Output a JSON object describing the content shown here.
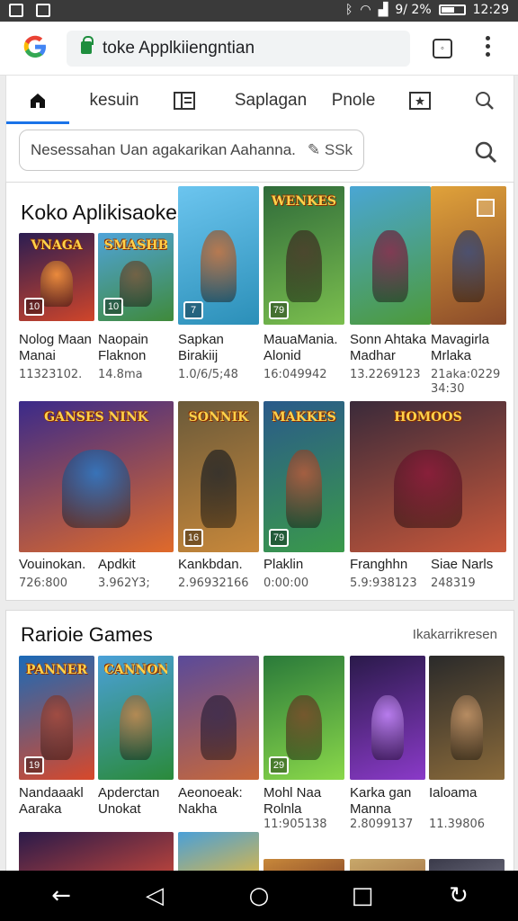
{
  "status": {
    "battery": "9/ 2%",
    "time": "12:29"
  },
  "browser": {
    "url": "toke Applkiiengntian"
  },
  "tabs": [
    {
      "label": ""
    },
    {
      "label": "kesuin"
    },
    {
      "label": ""
    },
    {
      "label": "Saplagan"
    },
    {
      "label": "Pnole"
    },
    {
      "label": ""
    },
    {
      "label": ""
    }
  ],
  "search": {
    "placeholder": "Nesessahan Uan agakarikan Aahanna.",
    "suffix": "SSk"
  },
  "section1": {
    "title": "Koko Aplikisaokeannh",
    "row1": [
      {
        "name1": "Nolog Maan",
        "name2": "Manai",
        "meta1": "11323102.",
        "meta2": "",
        "badge": "10",
        "logo": "VNAGA",
        "c1": "#2b1d52",
        "c2": "#d0452a",
        "fig": "#ff9a3c"
      },
      {
        "name1": "Naopain",
        "name2": "Flaknon",
        "meta1": "14.8ma",
        "meta2": "",
        "badge": "10",
        "logo": "SMASHBLE",
        "c1": "#4fa3d8",
        "c2": "#3f8a3a",
        "fig": "#7a5a3a"
      },
      {
        "name1": "Sapkan",
        "name2": "Birakiij",
        "meta1": "1.0/6/5;48",
        "meta2": "",
        "badge": "7",
        "logo": "",
        "c1": "#6cc5ef",
        "c2": "#2b8fb8",
        "fig": "#c9713a"
      },
      {
        "name1": "MauaMania.",
        "name2": "Alonid",
        "meta1": "16:049942",
        "meta2": "",
        "badge": "79",
        "logo": "WENKES",
        "c1": "#2f6b3a",
        "c2": "#7bbf4e",
        "fig": "#4a3a2a"
      },
      {
        "name1": "Sonn Ahtaka",
        "name2": "Madhar",
        "meta1": "13.2269123",
        "meta2": "",
        "badge": "",
        "logo": "",
        "c1": "#4aa6d4",
        "c2": "#4c9a3a",
        "fig": "#8a2a4a"
      },
      {
        "name1": "Mavagirla",
        "name2": "Mrlaka",
        "meta1": "21aka:0229",
        "meta2": "34:30",
        "badge": "",
        "logo": "",
        "c1": "#e0a23a",
        "c2": "#8a4a2a",
        "fig": "#3a4a7a"
      }
    ],
    "row2": [
      {
        "name1": "Vouinokan.",
        "meta1": "726:800",
        "badge": "",
        "logo": "GANSES NINK",
        "c1": "#3a2a8a",
        "c2": "#e06a2a",
        "fig": "#2a7ac8"
      },
      {
        "name1": "Apdkit",
        "meta1": "3.962Y3;",
        "badge": "16",
        "logo": "SONNIK",
        "c1": "#6a5a3a",
        "c2": "#c8883a",
        "fig": "#2a2a2a"
      },
      {
        "name1": "Kankbdan.",
        "meta1": "2.96932166",
        "badge": "79",
        "logo": "MAKKES",
        "c1": "#2a5a8a",
        "c2": "#3a9a4a",
        "fig": "#b85a3a"
      },
      {
        "name1": "Plaklin",
        "meta1": "0:00:00",
        "badge": "",
        "logo": "",
        "c1": "",
        "c2": "",
        "fig": ""
      },
      {
        "name1": "Franghhn",
        "meta1": "5.9:938123",
        "badge": "",
        "logo": "HOMOOS",
        "c1": "#3a2a3a",
        "c2": "#c8583a",
        "fig": "#8a1a3a"
      },
      {
        "name1": "Siae Narls",
        "meta1": "248319",
        "badge": "",
        "logo": "",
        "c1": "",
        "c2": "",
        "fig": ""
      }
    ]
  },
  "section2": {
    "title": "Rarioie Games",
    "link": "Ikakarrikresen",
    "row1": [
      {
        "name1": "Nandaaakl",
        "name2": "Aaraka",
        "meta1": "",
        "badge": "19",
        "logo": "PANNER",
        "c1": "#1a6ab8",
        "c2": "#d8482a",
        "fig": "#a84a3a"
      },
      {
        "name1": "Apderctan",
        "name2": "Unokat",
        "meta1": "",
        "badge": "",
        "logo": "CANNON",
        "c1": "#4aa0d8",
        "c2": "#2a8a3a",
        "fig": "#c8884a"
      },
      {
        "name1": "Aeonoeak:",
        "name2": "Nakha",
        "meta1": "",
        "badge": "",
        "logo": "",
        "c1": "#5a4a9a",
        "c2": "#c8683a",
        "fig": "#3a2a4a"
      },
      {
        "name1": "Mohl Naa",
        "name2": "Rolnla",
        "meta1": "11:905138",
        "badge": "29",
        "logo": "",
        "c1": "#2a7a3a",
        "c2": "#8ad84a",
        "fig": "#7a4a2a"
      },
      {
        "name1": "Karka gan",
        "name2": "Manna",
        "meta1": "2.8099137",
        "badge": "",
        "logo": "",
        "c1": "#2a1a4a",
        "c2": "#8a3ac8",
        "fig": "#c88aff"
      },
      {
        "name1": "Ialoama",
        "name2": "",
        "meta1": "11.39806",
        "badge": "",
        "logo": "",
        "c1": "#2a2a2a",
        "c2": "#8a6a3a",
        "fig": "#c8986a"
      }
    ]
  },
  "colors": {
    "accent": "#1a73e8",
    "lock": "#1e8e3e"
  }
}
